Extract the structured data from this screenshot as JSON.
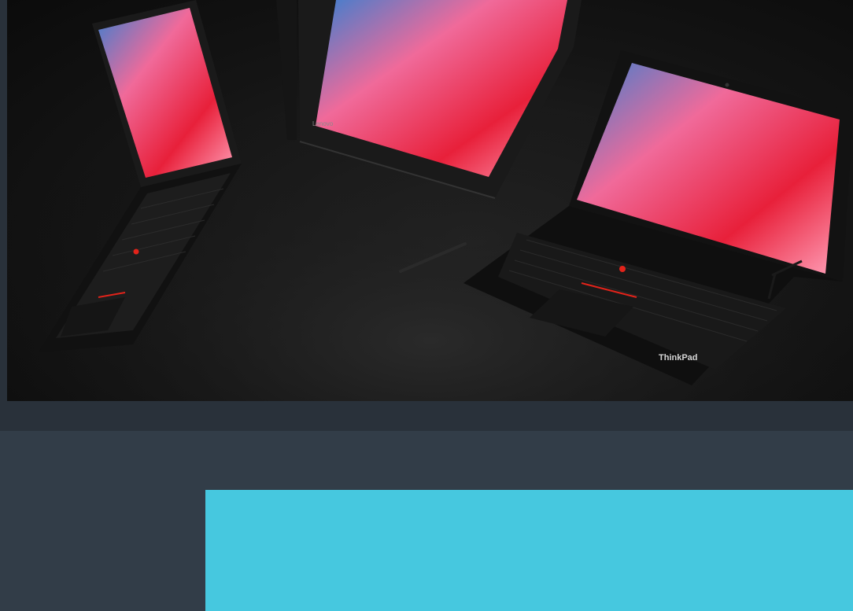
{
  "hero": {
    "brand_logo_text": "ThinkPad",
    "bezel_logo_text": "Lenovo"
  },
  "colors": {
    "page_background": "#2c3540",
    "section_background": "#323d48",
    "accent_panel": "#46c8df",
    "trackpoint_red": "#e2231a"
  }
}
